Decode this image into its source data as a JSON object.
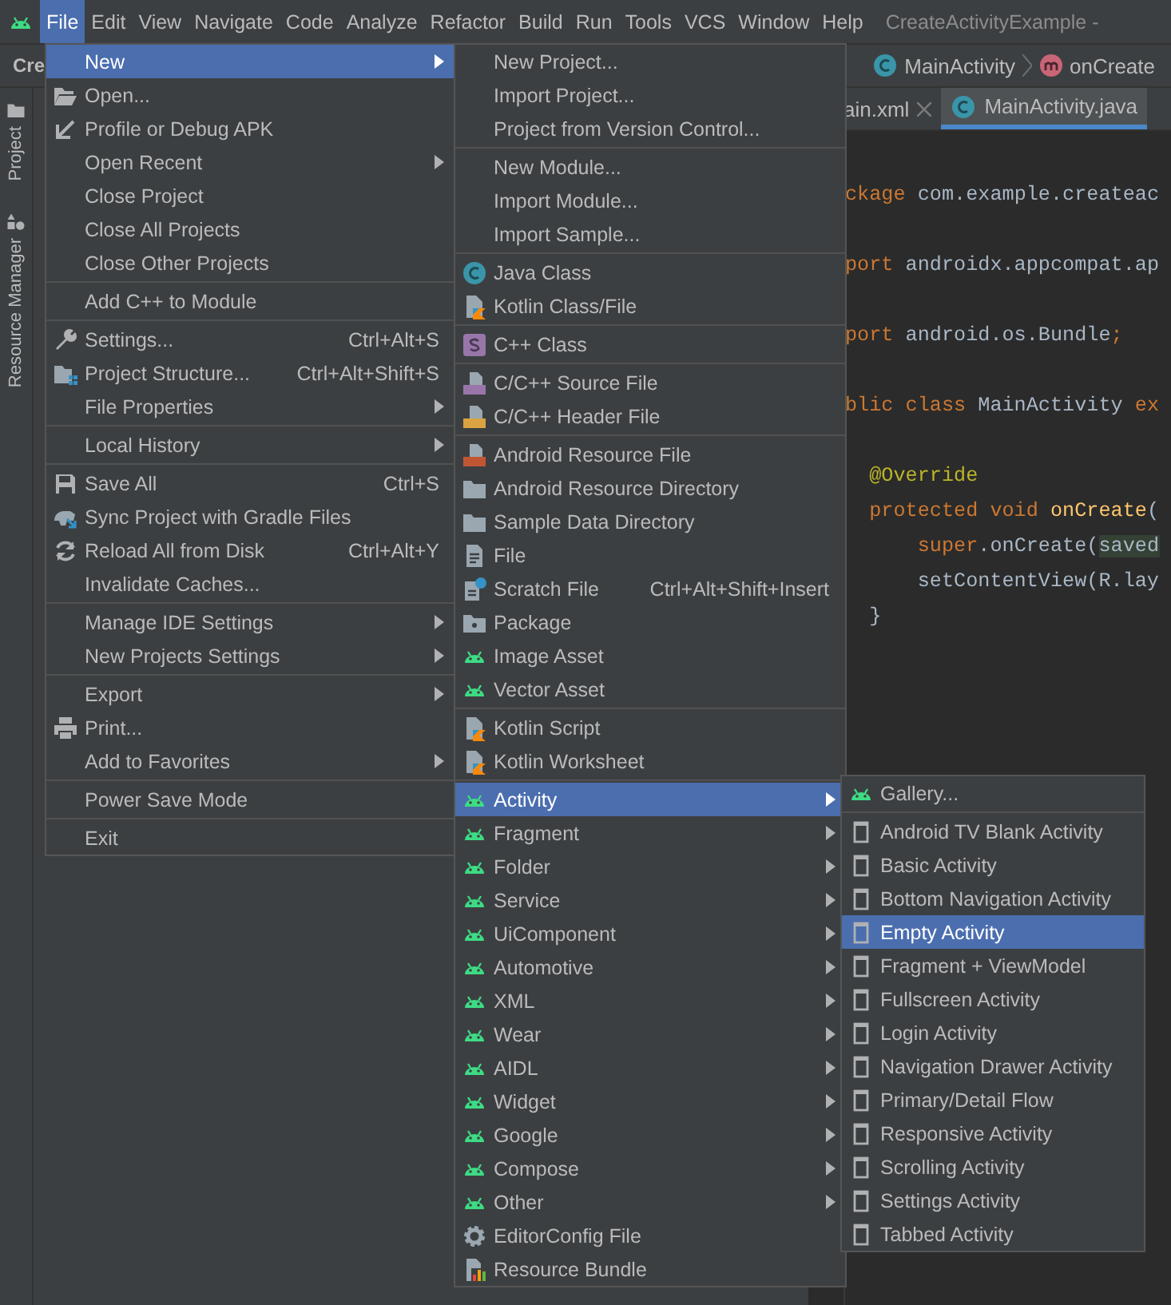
{
  "menubar": [
    {
      "label": "File",
      "selected": true
    },
    {
      "label": "Edit",
      "selected": false
    },
    {
      "label": "View",
      "selected": false
    },
    {
      "label": "Navigate",
      "selected": false
    },
    {
      "label": "Code",
      "selected": false
    },
    {
      "label": "Analyze",
      "selected": false
    },
    {
      "label": "Refactor",
      "selected": false
    },
    {
      "label": "Build",
      "selected": false
    },
    {
      "label": "Run",
      "selected": false
    },
    {
      "label": "Tools",
      "selected": false
    },
    {
      "label": "VCS",
      "selected": false
    },
    {
      "label": "Window",
      "selected": false
    },
    {
      "label": "Help",
      "selected": false
    }
  ],
  "window_title": "CreateActivityExample -",
  "toolbar": {
    "project": "Cre",
    "breadcrumbs": [
      {
        "label": "MainActivity"
      },
      {
        "label": "onCreate"
      }
    ]
  },
  "tool_strip": [
    "Project",
    "Resource Manager"
  ],
  "editor_tabs": [
    {
      "label": "ain.xml",
      "selected": false
    },
    {
      "label": "MainActivity.java",
      "selected": true
    }
  ],
  "code_lines": [
    {
      "kind": "code",
      "tokens": [
        {
          "text": "ckage",
          "kind": "keyword"
        },
        {
          "text": " com.example.createac",
          "kind": "plain"
        }
      ]
    },
    {
      "kind": "blank"
    },
    {
      "kind": "code",
      "tokens": [
        {
          "text": "port",
          "kind": "keyword"
        },
        {
          "text": " androidx.appcompat.ap",
          "kind": "plain"
        }
      ]
    },
    {
      "kind": "blank"
    },
    {
      "kind": "code",
      "tokens": [
        {
          "text": "port",
          "kind": "keyword"
        },
        {
          "text": " android.os.Bundle",
          "kind": "plain"
        },
        {
          "text": ";",
          "kind": "keyword"
        }
      ]
    },
    {
      "kind": "blank"
    },
    {
      "kind": "code",
      "tokens": [
        {
          "text": "blic class",
          "kind": "keyword"
        },
        {
          "text": " MainActivity ",
          "kind": "plain"
        },
        {
          "text": "ex",
          "kind": "keyword"
        }
      ]
    },
    {
      "kind": "blank"
    },
    {
      "kind": "code",
      "tokens": [
        {
          "text": "  @Override",
          "kind": "annotation"
        }
      ]
    },
    {
      "kind": "code",
      "tokens": [
        {
          "text": "  protected void ",
          "kind": "keyword"
        },
        {
          "text": "onCreate",
          "kind": "method"
        },
        {
          "text": "(",
          "kind": "plain"
        }
      ]
    },
    {
      "kind": "code",
      "tokens": [
        {
          "text": "      super",
          "kind": "keyword"
        },
        {
          "text": ".onCreate(",
          "kind": "plain"
        },
        {
          "text": "saved",
          "kind": "highlight"
        }
      ]
    },
    {
      "kind": "code",
      "tokens": [
        {
          "text": "      setContentView(R.lay",
          "kind": "plain"
        }
      ]
    },
    {
      "kind": "code",
      "tokens": [
        {
          "text": "  }",
          "kind": "plain"
        }
      ]
    }
  ],
  "file_menu": [
    {
      "kind": "item",
      "label": "New",
      "submenu": true,
      "selected": true
    },
    {
      "kind": "item",
      "label": "Open...",
      "submenu": false,
      "selected": false
    },
    {
      "kind": "item",
      "label": "Profile or Debug APK",
      "submenu": false,
      "selected": false
    },
    {
      "kind": "item",
      "label": "Open Recent",
      "submenu": true,
      "selected": false
    },
    {
      "kind": "item",
      "label": "Close Project",
      "submenu": false,
      "selected": false
    },
    {
      "kind": "item",
      "label": "Close All Projects",
      "submenu": false,
      "selected": false
    },
    {
      "kind": "item",
      "label": "Close Other Projects",
      "submenu": false,
      "selected": false
    },
    {
      "kind": "separator"
    },
    {
      "kind": "item",
      "label": "Add C++ to Module",
      "submenu": false,
      "selected": false
    },
    {
      "kind": "separator"
    },
    {
      "kind": "item",
      "label": "Settings...",
      "shortcut": "Ctrl+Alt+S",
      "submenu": false,
      "selected": false
    },
    {
      "kind": "item",
      "label": "Project Structure...",
      "shortcut": "Ctrl+Alt+Shift+S",
      "submenu": false,
      "selected": false
    },
    {
      "kind": "item",
      "label": "File Properties",
      "submenu": true,
      "selected": false
    },
    {
      "kind": "separator"
    },
    {
      "kind": "item",
      "label": "Local History",
      "submenu": true,
      "selected": false
    },
    {
      "kind": "separator"
    },
    {
      "kind": "item",
      "label": "Save All",
      "shortcut": "Ctrl+S",
      "submenu": false,
      "selected": false
    },
    {
      "kind": "item",
      "label": "Sync Project with Gradle Files",
      "submenu": false,
      "selected": false
    },
    {
      "kind": "item",
      "label": "Reload All from Disk",
      "shortcut": "Ctrl+Alt+Y",
      "submenu": false,
      "selected": false
    },
    {
      "kind": "item",
      "label": "Invalidate Caches...",
      "submenu": false,
      "selected": false
    },
    {
      "kind": "separator"
    },
    {
      "kind": "item",
      "label": "Manage IDE Settings",
      "submenu": true,
      "selected": false
    },
    {
      "kind": "item",
      "label": "New Projects Settings",
      "submenu": true,
      "selected": false
    },
    {
      "kind": "separator"
    },
    {
      "kind": "item",
      "label": "Export",
      "submenu": true,
      "selected": false
    },
    {
      "kind": "item",
      "label": "Print...",
      "submenu": false,
      "selected": false
    },
    {
      "kind": "item",
      "label": "Add to Favorites",
      "submenu": true,
      "selected": false
    },
    {
      "kind": "separator"
    },
    {
      "kind": "item",
      "label": "Power Save Mode",
      "submenu": false,
      "selected": false
    },
    {
      "kind": "separator"
    },
    {
      "kind": "item",
      "label": "Exit",
      "submenu": false,
      "selected": false
    }
  ],
  "new_menu": [
    {
      "kind": "item",
      "label": "New Project...",
      "submenu": false,
      "selected": false
    },
    {
      "kind": "item",
      "label": "Import Project...",
      "submenu": false,
      "selected": false
    },
    {
      "kind": "item",
      "label": "Project from Version Control...",
      "submenu": false,
      "selected": false
    },
    {
      "kind": "separator"
    },
    {
      "kind": "item",
      "label": "New Module...",
      "submenu": false,
      "selected": false
    },
    {
      "kind": "item",
      "label": "Import Module...",
      "submenu": false,
      "selected": false
    },
    {
      "kind": "item",
      "label": "Import Sample...",
      "submenu": false,
      "selected": false
    },
    {
      "kind": "separator"
    },
    {
      "kind": "item",
      "label": "Java Class",
      "submenu": false,
      "selected": false
    },
    {
      "kind": "item",
      "label": "Kotlin Class/File",
      "submenu": false,
      "selected": false
    },
    {
      "kind": "separator"
    },
    {
      "kind": "item",
      "label": "C++ Class",
      "submenu": false,
      "selected": false
    },
    {
      "kind": "separator"
    },
    {
      "kind": "item",
      "label": "C/C++ Source File",
      "submenu": false,
      "selected": false
    },
    {
      "kind": "item",
      "label": "C/C++ Header File",
      "submenu": false,
      "selected": false
    },
    {
      "kind": "separator"
    },
    {
      "kind": "item",
      "label": "Android Resource File",
      "submenu": false,
      "selected": false
    },
    {
      "kind": "item",
      "label": "Android Resource Directory",
      "submenu": false,
      "selected": false
    },
    {
      "kind": "item",
      "label": "Sample Data Directory",
      "submenu": false,
      "selected": false
    },
    {
      "kind": "item",
      "label": "File",
      "submenu": false,
      "selected": false
    },
    {
      "kind": "item",
      "label": "Scratch File",
      "shortcut": "Ctrl+Alt+Shift+Insert",
      "submenu": false,
      "selected": false
    },
    {
      "kind": "item",
      "label": "Package",
      "submenu": false,
      "selected": false
    },
    {
      "kind": "item",
      "label": "Image Asset",
      "submenu": false,
      "selected": false
    },
    {
      "kind": "item",
      "label": "Vector Asset",
      "submenu": false,
      "selected": false
    },
    {
      "kind": "separator"
    },
    {
      "kind": "item",
      "label": "Kotlin Script",
      "submenu": false,
      "selected": false
    },
    {
      "kind": "item",
      "label": "Kotlin Worksheet",
      "submenu": false,
      "selected": false
    },
    {
      "kind": "separator"
    },
    {
      "kind": "item",
      "label": "Activity",
      "submenu": true,
      "selected": true
    },
    {
      "kind": "item",
      "label": "Fragment",
      "submenu": true,
      "selected": false
    },
    {
      "kind": "item",
      "label": "Folder",
      "submenu": true,
      "selected": false
    },
    {
      "kind": "item",
      "label": "Service",
      "submenu": true,
      "selected": false
    },
    {
      "kind": "item",
      "label": "UiComponent",
      "submenu": true,
      "selected": false
    },
    {
      "kind": "item",
      "label": "Automotive",
      "submenu": true,
      "selected": false
    },
    {
      "kind": "item",
      "label": "XML",
      "submenu": true,
      "selected": false
    },
    {
      "kind": "item",
      "label": "Wear",
      "submenu": true,
      "selected": false
    },
    {
      "kind": "item",
      "label": "AIDL",
      "submenu": true,
      "selected": false
    },
    {
      "kind": "item",
      "label": "Widget",
      "submenu": true,
      "selected": false
    },
    {
      "kind": "item",
      "label": "Google",
      "submenu": true,
      "selected": false
    },
    {
      "kind": "item",
      "label": "Compose",
      "submenu": true,
      "selected": false
    },
    {
      "kind": "item",
      "label": "Other",
      "submenu": true,
      "selected": false
    },
    {
      "kind": "item",
      "label": "EditorConfig File",
      "submenu": false,
      "selected": false
    },
    {
      "kind": "item",
      "label": "Resource Bundle",
      "submenu": false,
      "selected": false
    }
  ],
  "activity_menu": [
    {
      "kind": "item",
      "label": "Gallery...",
      "selected": false
    },
    {
      "kind": "separator"
    },
    {
      "kind": "item",
      "label": "Android TV Blank Activity",
      "selected": false
    },
    {
      "kind": "item",
      "label": "Basic Activity",
      "selected": false
    },
    {
      "kind": "item",
      "label": "Bottom Navigation Activity",
      "selected": false
    },
    {
      "kind": "item",
      "label": "Empty Activity",
      "selected": true
    },
    {
      "kind": "item",
      "label": "Fragment + ViewModel",
      "selected": false
    },
    {
      "kind": "item",
      "label": "Fullscreen Activity",
      "selected": false
    },
    {
      "kind": "item",
      "label": "Login Activity",
      "selected": false
    },
    {
      "kind": "item",
      "label": "Navigation Drawer Activity",
      "selected": false
    },
    {
      "kind": "item",
      "label": "Primary/Detail Flow",
      "selected": false
    },
    {
      "kind": "item",
      "label": "Responsive Activity",
      "selected": false
    },
    {
      "kind": "item",
      "label": "Scrolling Activity",
      "selected": false
    },
    {
      "kind": "item",
      "label": "Settings Activity",
      "selected": false
    },
    {
      "kind": "item",
      "label": "Tabbed Activity",
      "selected": false
    }
  ]
}
